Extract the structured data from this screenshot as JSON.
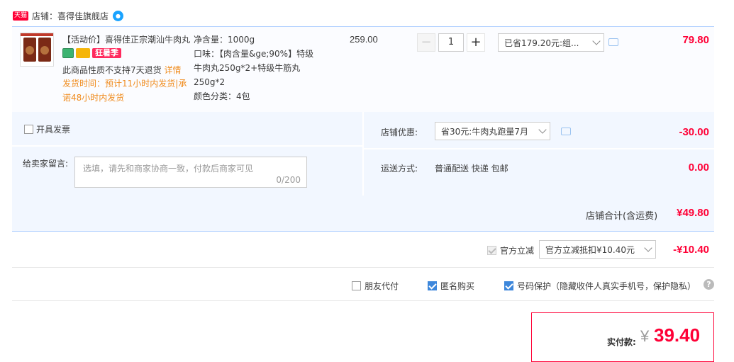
{
  "shop": {
    "badge": "天猫",
    "label": "店铺：喜得佳旗舰店"
  },
  "item": {
    "title": "【活动价】喜得佳正宗潮汕牛肉丸",
    "promo_tag": "狂暑季",
    "no_return": "此商品性质不支持7天退货",
    "detail_link": "详情",
    "ship_time": "发货时间：预计11小时内发货|承诺48小时内发货",
    "attrs": [
      "净含量：1000g",
      "口味：【肉含量&ge;90%】特级牛肉丸250g*2+特级牛筋丸250g*2",
      "颜色分类：4包"
    ],
    "unit_price": "259.00",
    "quantity": "1",
    "discount_select": "已省179.20元:组...",
    "subtotal": "79.80"
  },
  "invoice_label": "开具发票",
  "message": {
    "label": "给卖家留言:",
    "placeholder": "选填，请先和商家协商一致，付款后商家可见",
    "count": "0/200"
  },
  "shop_discount": {
    "label": "店铺优惠:",
    "select": "省30元:牛肉丸跑量7月",
    "amount": "-30.00"
  },
  "shipping": {
    "label": "运送方式:",
    "method": "普通配送 快递 包邮",
    "amount": "0.00"
  },
  "shop_total": {
    "label": "店铺合计(含运费)",
    "amount": "¥49.80"
  },
  "official_discount": {
    "label": "官方立减",
    "select": "官方立减抵扣¥10.40元",
    "amount": "-¥10.40"
  },
  "options": [
    {
      "label": "朋友代付",
      "checked": false
    },
    {
      "label": "匿名购买",
      "checked": true
    },
    {
      "label": "号码保护（隐藏收件人真实手机号，保护隐私）",
      "checked": true
    }
  ],
  "pay": {
    "label": "实付款:",
    "currency": "¥",
    "amount": "39.40"
  },
  "colors": {
    "accent": "#ff0036",
    "blue": "#3d87db",
    "panel": "#f2f7ff"
  }
}
